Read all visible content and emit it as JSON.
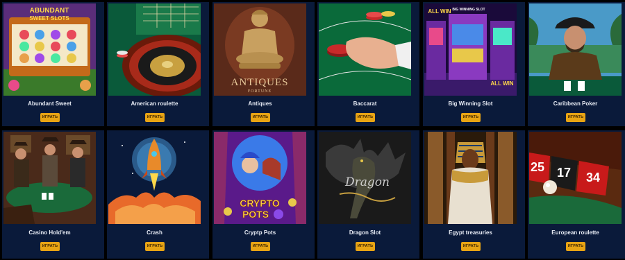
{
  "play_label": "ИГРАТЬ",
  "games": [
    {
      "title": "Abundant Sweet",
      "thumb_text": [
        "ABUNDANT",
        "SWEET SLOTS"
      ]
    },
    {
      "title": "American roulette"
    },
    {
      "title": "Antiques",
      "thumb_text": [
        "ANTIQUES",
        "FORTUNE"
      ]
    },
    {
      "title": "Baccarat"
    },
    {
      "title": "Big Winning Slot",
      "thumb_text": [
        "ALL WIN",
        "BIG WINNING SLOT",
        "ALL WIN"
      ]
    },
    {
      "title": "Caribbean Poker"
    },
    {
      "title": "Casino Hold'em"
    },
    {
      "title": "Crash"
    },
    {
      "title": "Cryptp Pots",
      "thumb_text": [
        "CRYPTO",
        "POTS"
      ]
    },
    {
      "title": "Dragon Slot",
      "thumb_text": [
        "Dragon"
      ]
    },
    {
      "title": "Egypt treasuries"
    },
    {
      "title": "European roulette",
      "thumb_text": [
        "25",
        "17",
        "34"
      ]
    }
  ],
  "colors": {
    "page_bg": "#000000",
    "card_bg": "#0a1a3a",
    "button_bg": "#e8a414",
    "title_text": "#e8ecf5"
  }
}
